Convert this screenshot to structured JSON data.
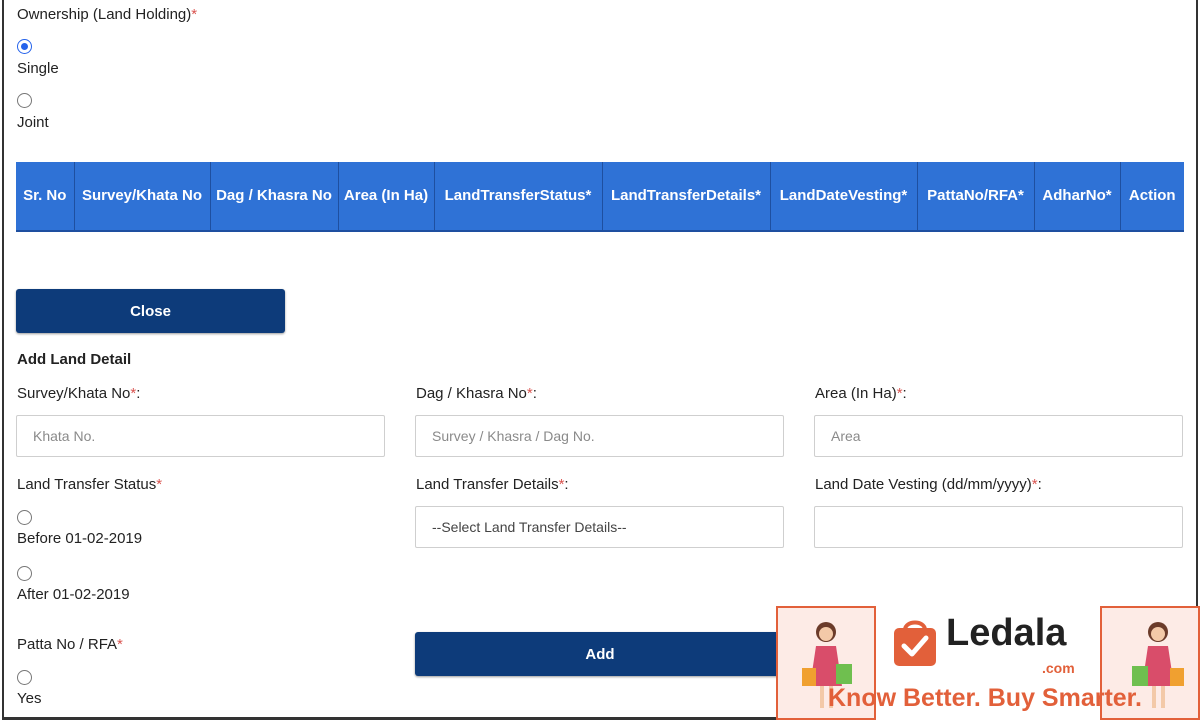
{
  "ownership": {
    "label": "Ownership (Land Holding)",
    "required": "*",
    "options": [
      {
        "label": "Single",
        "checked": true
      },
      {
        "label": "Joint",
        "checked": false
      }
    ]
  },
  "table": {
    "headers": [
      "Sr. No",
      "Survey/Khata No",
      "Dag / Khasra No",
      "Area (In Ha)",
      "LandTransferStatus*",
      "LandTransferDetails*",
      "LandDateVesting*",
      "PattaNo/RFA*",
      "AdharNo*",
      "Action"
    ]
  },
  "close_button": "Close",
  "add_land_detail": {
    "title": "Add Land Detail",
    "survey": {
      "label": "Survey/Khata No",
      "required": "*",
      "colon": ":",
      "placeholder": "Khata No."
    },
    "dag": {
      "label": "Dag / Khasra No",
      "required": "*",
      "colon": ":",
      "placeholder": "Survey / Khasra / Dag No."
    },
    "area": {
      "label": "Area (In Ha)",
      "required": "*",
      "colon": ":",
      "placeholder": "Area"
    },
    "transfer_status": {
      "label": "Land Transfer Status",
      "required": "*",
      "options": [
        {
          "label": "Before 01-02-2019"
        },
        {
          "label": "After 01-02-2019"
        }
      ]
    },
    "transfer_details": {
      "label": "Land Transfer Details",
      "required": "*",
      "colon": ":",
      "selected": "--Select Land Transfer Details--"
    },
    "date_vesting": {
      "label": "Land Date Vesting (dd/mm/yyyy)",
      "required": "*",
      "colon": ":",
      "value": ""
    },
    "patta": {
      "label": "Patta No / RFA",
      "required": "*",
      "options": [
        {
          "label": "Yes"
        }
      ]
    },
    "add_button": "Add"
  },
  "ad": {
    "brand": "Ledala",
    "domain": ".com",
    "tagline": "Know Better. Buy Smarter.",
    "accent": "#e2603a"
  },
  "colors": {
    "table_header": "#2f72d6",
    "button": "#0d3b7a",
    "required": "#d9534f"
  }
}
